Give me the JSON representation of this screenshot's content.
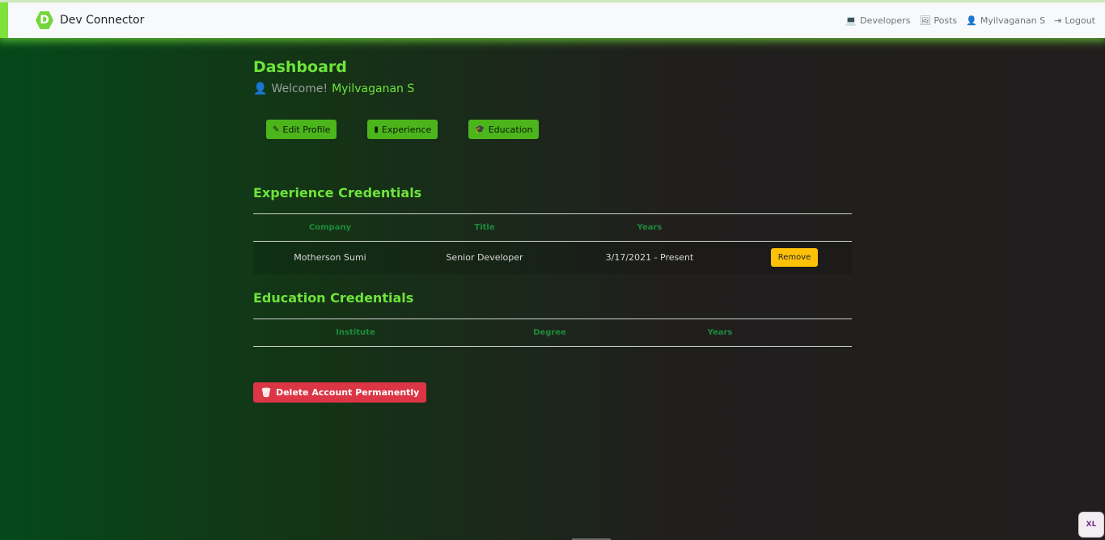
{
  "navbar": {
    "brand_letter": "D",
    "brand_name": "Dev Connector",
    "links": [
      {
        "label": "Developers",
        "icon": "laptop-icon"
      },
      {
        "label": "Posts",
        "icon": "images-icon"
      },
      {
        "label": "Myilvaganan S",
        "icon": "user-icon"
      },
      {
        "label": "Logout",
        "icon": "sign-out-icon"
      }
    ]
  },
  "dashboard": {
    "title": "Dashboard",
    "welcome_prefix": "Welcome!",
    "user_name": "Myilvaganan S"
  },
  "actions": {
    "edit_profile": "Edit Profile",
    "experience": "Experience",
    "education": "Education"
  },
  "experience": {
    "title": "Experience Credentials",
    "headers": [
      "Company",
      "Title",
      "Years"
    ],
    "rows": [
      {
        "company": "Motherson Sumi",
        "title": "Senior Developer",
        "years": "3/17/2021 - Present",
        "action": "Remove"
      }
    ]
  },
  "education": {
    "title": "Education Credentials",
    "headers": [
      "Institute",
      "Degree",
      "Years"
    ]
  },
  "delete_account": "Delete Account Permanently",
  "screen_badge": "XL",
  "colors": {
    "accent": "#6ee43a",
    "button_green": "#4cb51c",
    "warning": "#ffc107",
    "danger": "#dc3545"
  }
}
